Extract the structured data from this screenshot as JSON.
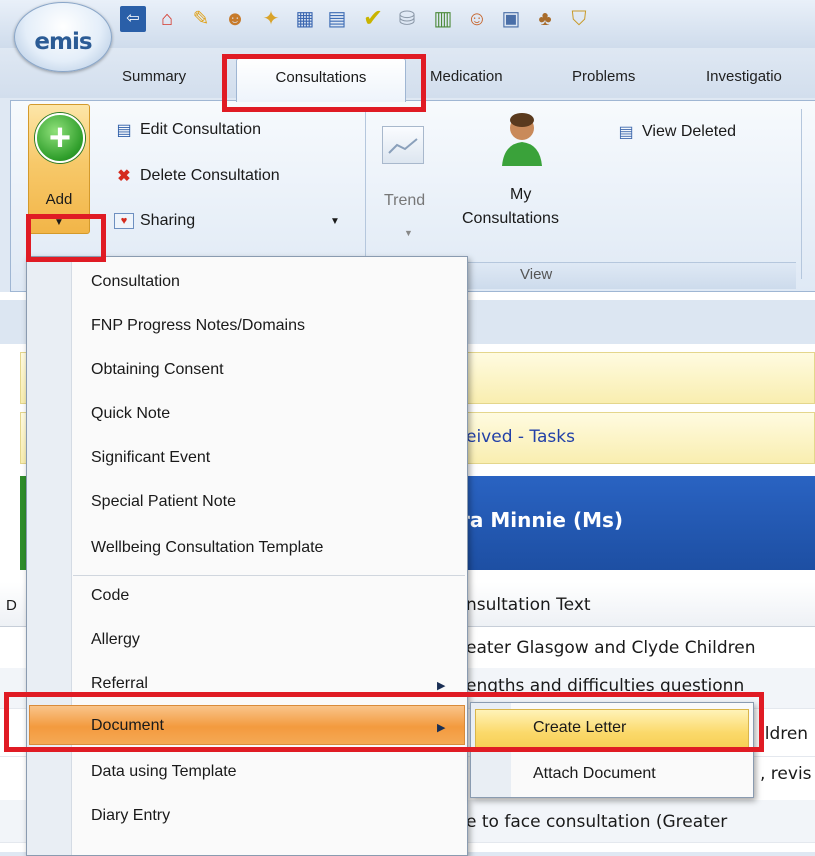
{
  "app": {
    "logo_text": "emis"
  },
  "colors": {
    "highlight": "#e01b24",
    "menu_hover": "#f39a3e",
    "banner": "#2a63c2"
  },
  "quick_access": {
    "icons": [
      "back-arrow-icon",
      "home-icon",
      "pencil-icon",
      "user-settings-icon",
      "magic-wand-icon",
      "chart-icon",
      "calendar-icon",
      "checkmark-icon",
      "database-icon",
      "report-icon",
      "users-icon",
      "document-icon",
      "hierarchy-icon",
      "shield-icon"
    ]
  },
  "tabs": [
    "Summary",
    "Consultations",
    "Medication",
    "Problems",
    "Investigatio"
  ],
  "ribbon": {
    "add_label": "Add",
    "edit_consultation": "Edit Consultation",
    "delete_consultation": "Delete Consultation",
    "sharing": "Sharing",
    "trend": "Trend",
    "my_consultations_line1": "My",
    "my_consultations_line2": "Consultations",
    "view_deleted": "View Deleted",
    "group_view": "View"
  },
  "background": {
    "tasks_text": "eived - Tasks",
    "patient_name": "ra Minnie (Ms)",
    "col_edge": "D",
    "column_header": "nsultation Text",
    "rows": [
      "eater Glasgow and Clyde Children",
      "engths and difficulties questionn",
      "ildren",
      ", revis",
      "e to face consultation (Greater"
    ]
  },
  "menu": {
    "items": [
      "Consultation",
      "FNP Progress Notes/Domains",
      "Obtaining Consent",
      "Quick Note",
      "Significant Event",
      "Special Patient Note",
      "Wellbeing Consultation Template",
      "Code",
      "Allergy",
      "Referral",
      "Document",
      "Data using Template",
      "Diary Entry"
    ]
  },
  "submenu": {
    "items": [
      "Create Letter",
      "Attach Document"
    ]
  }
}
